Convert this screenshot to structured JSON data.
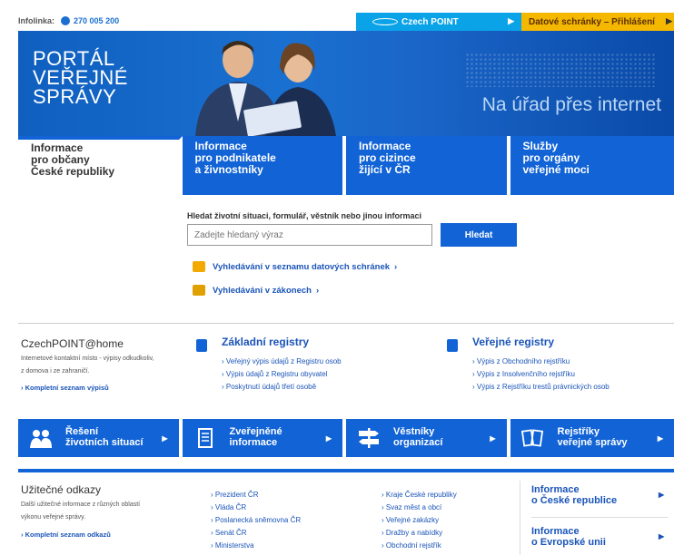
{
  "topbar": {
    "infolinka_label": "Infolinka:",
    "phone": "270 005 200",
    "czechpoint_label": "Czech POINT",
    "datove_label": "Datové schránky – Přihlášení"
  },
  "banner": {
    "title_line1": "PORTÁL",
    "title_line2": "VEŘEJNÉ",
    "title_line3": "SPRÁVY",
    "slogan": "Na úřad přes internet"
  },
  "tabs": [
    {
      "line1": "Informace",
      "line2": "pro občany",
      "line3": "České republiky"
    },
    {
      "line1": "Informace",
      "line2": "pro podnikatele",
      "line3": "a živnostníky"
    },
    {
      "line1": "Informace",
      "line2": "pro cizince",
      "line3": "žijící v ČR"
    },
    {
      "line1": "Služby",
      "line2": "pro orgány",
      "line3": "veřejné moci"
    }
  ],
  "search": {
    "label": "Hledat životní situaci, formulář, věstník nebo jinou informaci",
    "placeholder": "Zadejte hledaný výraz",
    "button": "Hledat",
    "link1": "Vyhledávání v seznamu datových schránek",
    "link2": "Vyhledávání v zákonech"
  },
  "czechpoint": {
    "title": "CzechPOINT@home",
    "desc_line1": "Internetové kontaktní místo - výpisy odkudkoliv,",
    "desc_line2": "z domova i ze zahraničí.",
    "more": "Kompletní seznam výpisů"
  },
  "zakladni": {
    "title": "Základní registry",
    "items": [
      "Veřejný výpis údajů z Registru osob",
      "Výpis údajů z Registru obyvatel",
      "Poskytnutí údajů třetí osobě"
    ]
  },
  "verejne": {
    "title": "Veřejné registry",
    "items": [
      "Výpis z Obchodního rejstříku",
      "Výpis z Insolvenčního rejstříku",
      "Výpis z Rejstříku trestů právnických osob"
    ]
  },
  "bbar": [
    {
      "line1": "Řešení",
      "line2": "životních situací",
      "icon": "people-icon"
    },
    {
      "line1": "Zveřejněné",
      "line2": "informace",
      "icon": "document-icon"
    },
    {
      "line1": "Věstníky",
      "line2": "organizací",
      "icon": "signpost-icon"
    },
    {
      "line1": "Rejstříky",
      "line2": "veřejné správy",
      "icon": "books-icon"
    }
  ],
  "useful": {
    "title": "Užitečné odkazy",
    "desc_line1": "Další užitečné informace z různých oblastí",
    "desc_line2": "výkonu veřejné správy.",
    "more": "Kompletní seznam odkazů",
    "col1": [
      "Prezident ČR",
      "Vláda ČR",
      "Poslanecká sněmovna ČR",
      "Senát ČR",
      "Ministerstva"
    ],
    "col2": [
      "Kraje České republiky",
      "Svaz měst a obcí",
      "Veřejné zakázky",
      "Dražby a nabídky",
      "Obchodní rejstřík"
    ],
    "info1_line1": "Informace",
    "info1_line2": "o České republice",
    "info2_line1": "Informace",
    "info2_line2": "o Evropské unii"
  },
  "colors": {
    "primary_blue": "#1163d6",
    "czechpoint_blue": "#0aa3e8",
    "datove_yellow": "#f5b800"
  }
}
